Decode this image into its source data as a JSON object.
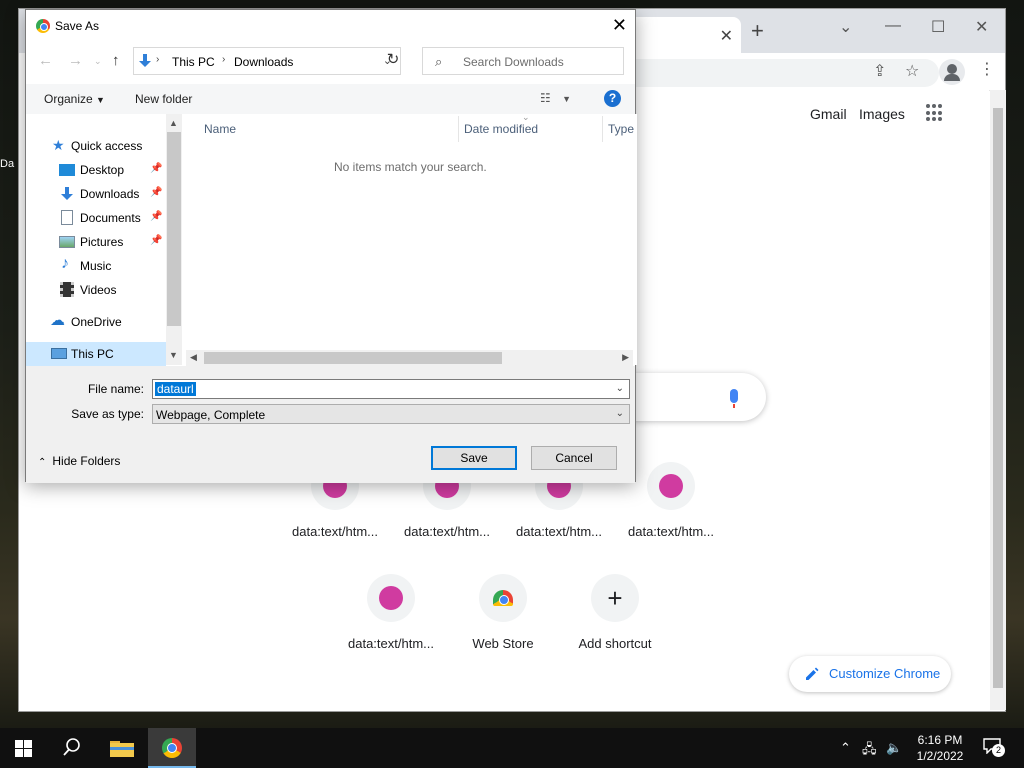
{
  "dialog": {
    "title": "Save As",
    "address": {
      "part1": "This PC",
      "part2": "Downloads"
    },
    "search_placeholder": "Search Downloads",
    "commands": {
      "organize": "Organize",
      "new_folder": "New folder"
    },
    "nav_pane": {
      "quick_access": "Quick access",
      "items": [
        "Desktop",
        "Downloads",
        "Documents",
        "Pictures",
        "Music",
        "Videos"
      ],
      "onedrive": "OneDrive",
      "this_pc": "This PC"
    },
    "columns": [
      "Name",
      "Date modified",
      "Type"
    ],
    "empty_message": "No items match your search.",
    "file_name_label": "File name:",
    "file_name_value": "dataurl",
    "save_type_label": "Save as type:",
    "save_type_value": "Webpage, Complete",
    "hide_folders": "Hide Folders",
    "save_button": "Save",
    "cancel_button": "Cancel"
  },
  "chrome": {
    "gmail": "Gmail",
    "images": "Images",
    "shortcuts_row1": [
      "data:text/htm...",
      "data:text/htm...",
      "data:text/htm...",
      "data:text/htm..."
    ],
    "shortcuts_row2": [
      "data:text/htm...",
      "Web Store",
      "Add shortcut"
    ],
    "customize": "Customize Chrome"
  },
  "desktop": {
    "icon_fragment": "Da"
  },
  "taskbar": {
    "time": "6:16 PM",
    "date": "1/2/2022",
    "notification_count": "2"
  },
  "colors": {
    "accent": "#0078d7",
    "shortcut_dot": "#d03ba0",
    "chrome_blue": "#1a73e8"
  }
}
